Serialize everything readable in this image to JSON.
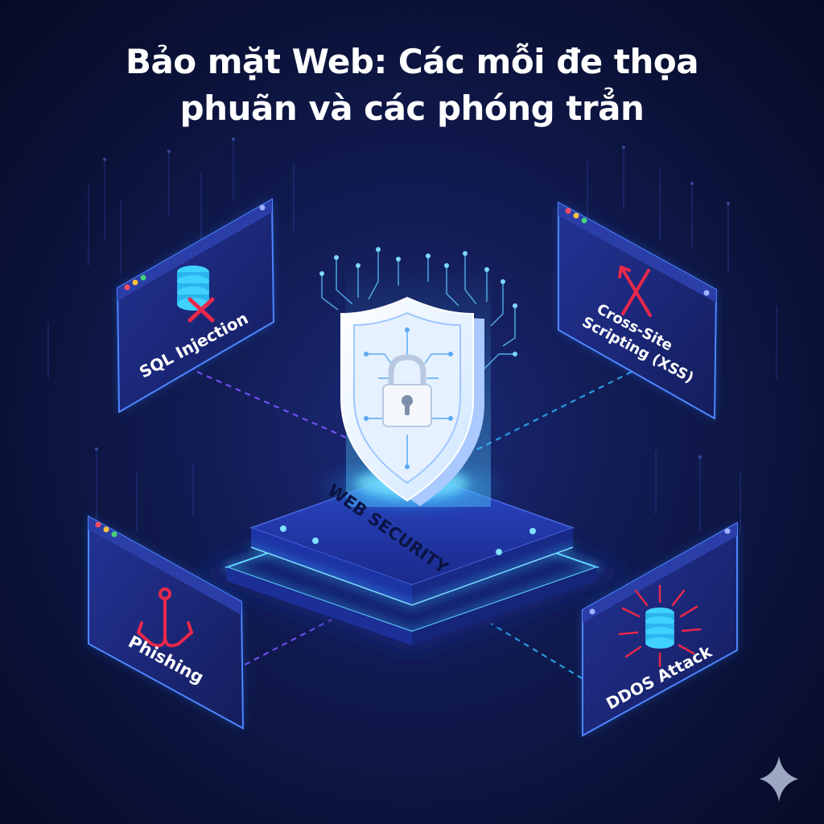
{
  "title": {
    "line1": "Bảo mặt Web: Các mỗi đe thọa",
    "line2": "phuãn và các phóng trẳn"
  },
  "center": {
    "label": "WEB SECURITY",
    "icon": "shield-lock-icon"
  },
  "threats": {
    "sql": {
      "label": "SQL Injection",
      "icon": "database-x-icon"
    },
    "xss": {
      "label_line1": "Cross-Site",
      "label_line2": "Scripting (XSS)",
      "icon": "red-x-icon"
    },
    "phishing": {
      "label": "Phishing",
      "icon": "fishing-hook-icon"
    },
    "ddos": {
      "label": "DDOS Attack",
      "icon": "database-burst-icon"
    }
  },
  "colors": {
    "accent": "#29b6ff",
    "danger": "#e8284a",
    "panel": "#1a2770",
    "background": "#0b1238"
  }
}
